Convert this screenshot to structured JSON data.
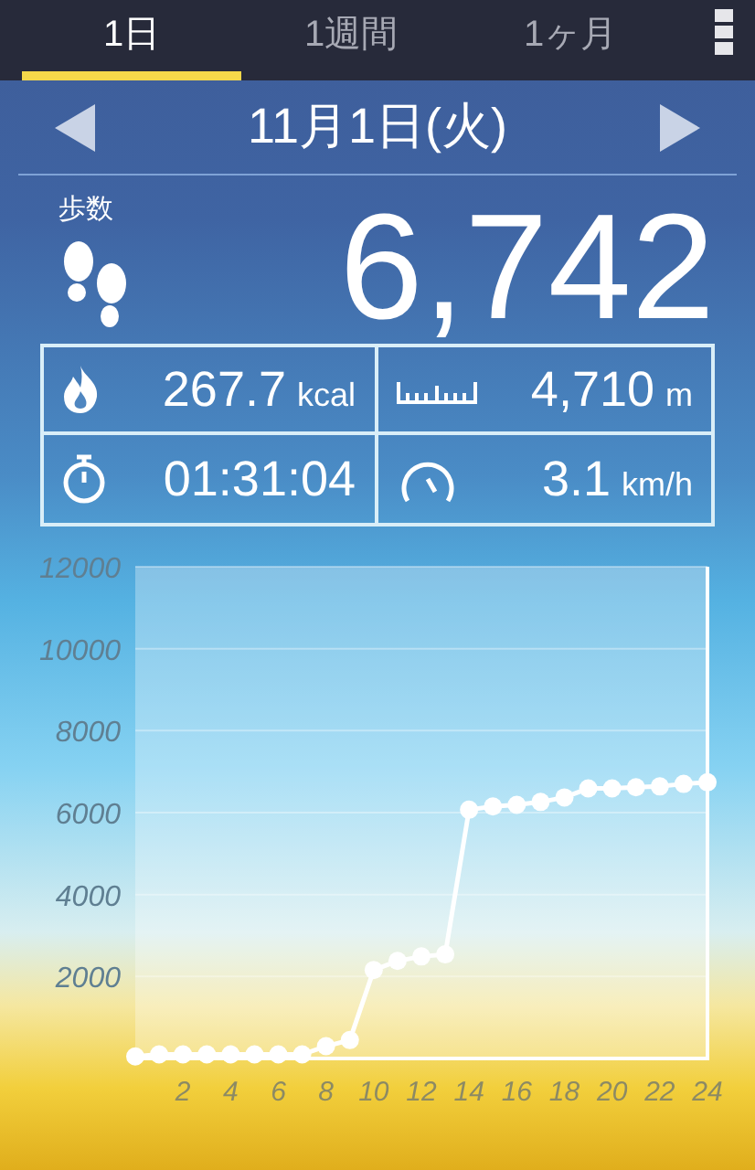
{
  "tabs": [
    {
      "label": "1日",
      "selected": true
    },
    {
      "label": "1週間",
      "selected": false
    },
    {
      "label": "1ヶ月",
      "selected": false
    }
  ],
  "date_nav": {
    "title": "11月1日(火)"
  },
  "steps": {
    "label": "歩数",
    "value": "6,742"
  },
  "stats": [
    {
      "kind": "calories",
      "value": "267.7",
      "unit": "kcal"
    },
    {
      "kind": "distance",
      "value": "4,710",
      "unit": "m"
    },
    {
      "kind": "time",
      "value": "01:31:04"
    },
    {
      "kind": "speed",
      "value": "3.1",
      "unit": "km/h"
    }
  ],
  "chart_data": {
    "type": "line",
    "x": [
      0,
      1,
      2,
      3,
      4,
      5,
      6,
      7,
      8,
      9,
      10,
      11,
      12,
      13,
      14,
      15,
      16,
      17,
      18,
      19,
      20,
      21,
      22,
      23,
      24
    ],
    "series": [
      {
        "color": "#ffffff",
        "marker": true,
        "values": [
          50,
          100,
          100,
          100,
          100,
          100,
          100,
          100,
          300,
          450,
          2160,
          2380,
          2490,
          2540,
          6070,
          6150,
          6190,
          6260,
          6370,
          6590,
          6590,
          6620,
          6640,
          6700,
          6740
        ]
      }
    ],
    "grid": true,
    "xlim": [
      0,
      24
    ],
    "ylim": [
      0,
      12000
    ],
    "xticks": [
      2,
      4,
      6,
      8,
      10,
      12,
      14,
      16,
      18,
      20,
      22,
      24
    ],
    "yticks": [
      2000,
      4000,
      6000,
      8000,
      10000,
      12000
    ]
  }
}
